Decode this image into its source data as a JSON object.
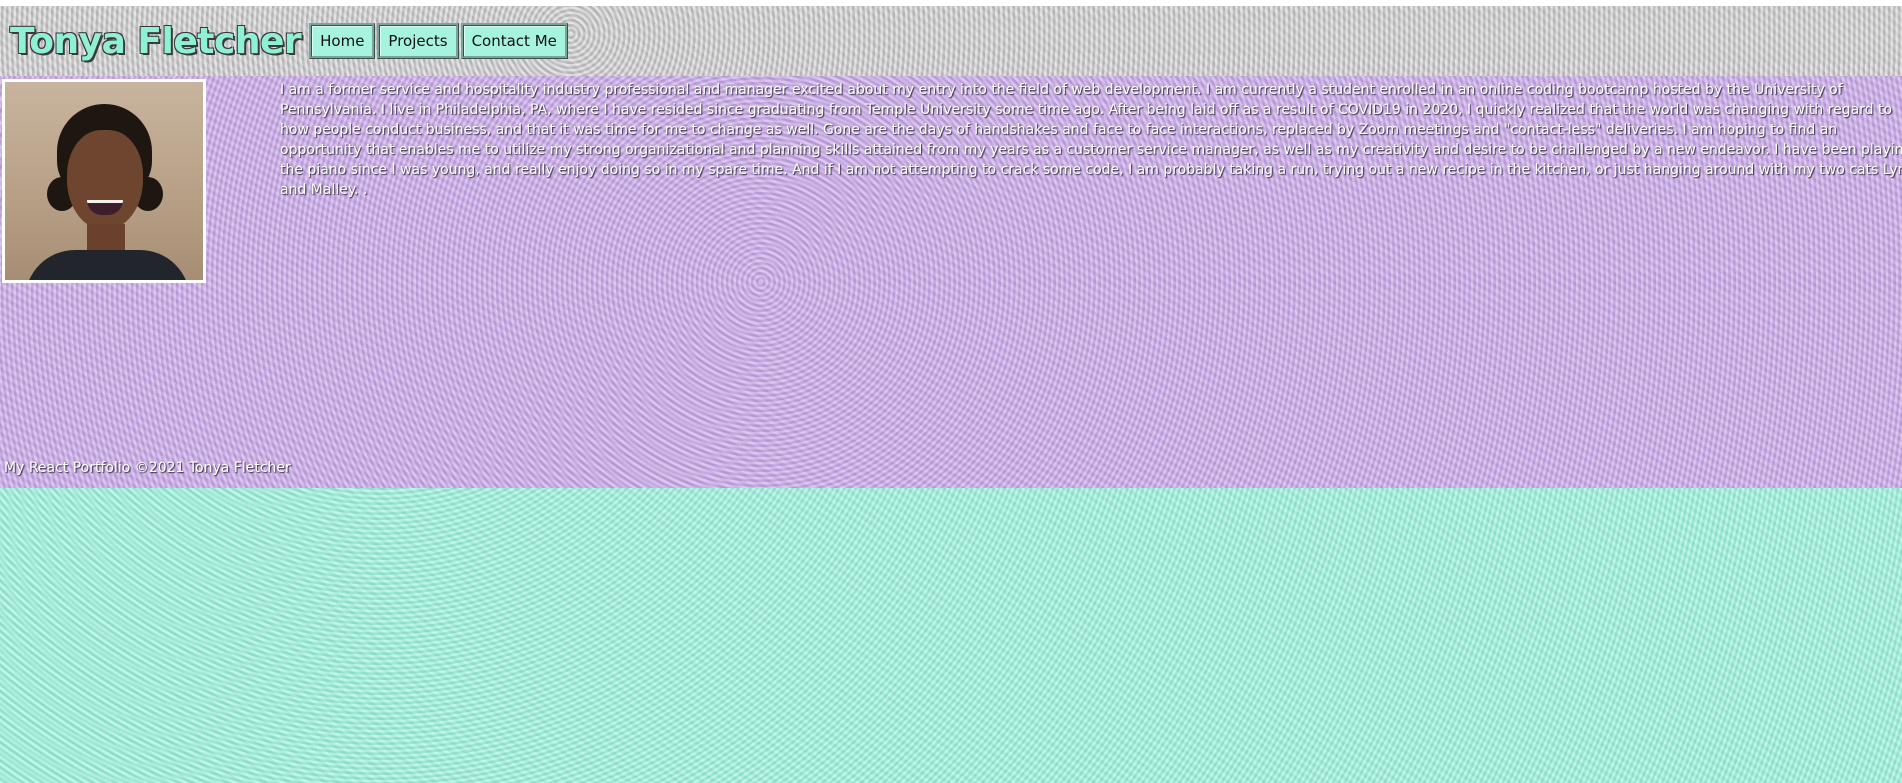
{
  "header": {
    "title": "Tonya Fletcher",
    "nav": [
      {
        "label": "Home"
      },
      {
        "label": "Projects"
      },
      {
        "label": "Contact Me"
      }
    ]
  },
  "about": {
    "photo_alt": "Tonya Fletcher portrait",
    "bio_lines": [
      "I am a former service and hospitality industry professional and manager excited about my entry into the field of web development. I am currently a student enrolled in an online coding bootcamp hosted by the University of",
      "Pennsylvania. I live in Philadelphia, PA, where I have resided since graduating from Temple University some time ago. After being laid off as a result of COVID19 in 2020, I quickly realized that the world was changing with regard to",
      "how people conduct business, and that it was time for me to change as well. Gone are the days of handshakes and face to face interactions, replaced by Zoom meetings and \"contact-less\" deliveries. I am hoping to find an",
      "opportunity that enables me to utilize my strong organizational and planning skills attained from my years as a customer service manager, as well as my creativity and desire to be challenged by a new endeavor. I have been playing",
      "the piano since I was young, and really enjoy doing so in my spare time. And if I am not attempting to crack some code, I am probably taking a run, trying out a new recipe in the kitchen, or just hanging around with my two cats Lyn",
      "and Malley. ."
    ]
  },
  "footer": {
    "text": "My React Portfolio ©2021 Tonya Fletcher"
  }
}
